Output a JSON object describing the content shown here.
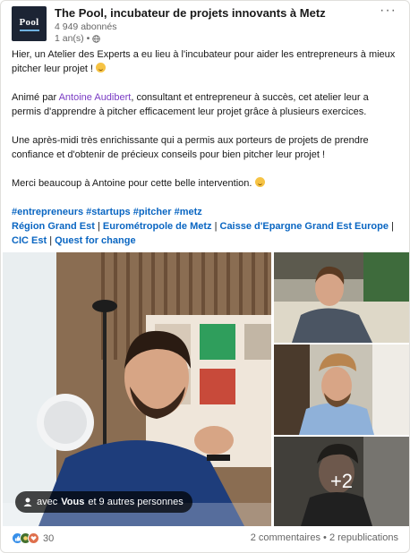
{
  "post": {
    "author": "The Pool, incubateur de projets innovants à Metz",
    "logo_text": "Pool",
    "followers": "4 949 abonnés",
    "time": "1 an(s) •",
    "more_label": "···"
  },
  "body": {
    "p1": "Hier, un Atelier des Experts a eu lieu à l'incubateur pour aider les entrepreneurs à mieux pitcher leur projet !",
    "p2_pre": "Animé par ",
    "p2_mention": "Antoine Audibert",
    "p2_post": ", consultant et entrepreneur à succès, cet atelier leur a permis d'apprendre à pitcher efficacement leur projet grâce à plusieurs exercices.",
    "p3": "Une après-midi très enrichissante qui a permis aux porteurs de projets de prendre confiance et d'obtenir de précieux conseils pour bien pitcher leur projet !",
    "p4": "Merci beaucoup à Antoine pour cette belle intervention.",
    "hashtags": [
      "#entrepreneurs",
      "#startups",
      "#pitcher",
      "#metz"
    ],
    "tags": [
      "Région Grand Est",
      "Eurométropole de Metz",
      "Caisse d'Epargne Grand Est Europe",
      "CIC Est",
      "Quest for change"
    ],
    "separator": "|"
  },
  "media": {
    "more_count": "+2",
    "tagged_prefix": "avec ",
    "tagged_you": "Vous",
    "tagged_suffix": " et 9 autres personnes"
  },
  "footer": {
    "reactions": "30",
    "comments": "2 commentaires",
    "dot": " • ",
    "reposts": "2 republications"
  }
}
